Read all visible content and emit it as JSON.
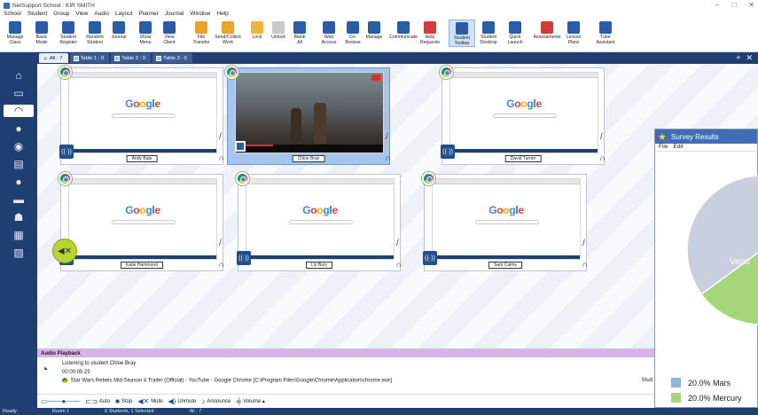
{
  "window": {
    "title": "NetSupport School : KIR SMITH",
    "controls": [
      "–",
      "□",
      "✕"
    ]
  },
  "menu": [
    "School",
    "Student",
    "Group",
    "View",
    "Audio",
    "Layout",
    "Planner",
    "Journal",
    "Window",
    "Help"
  ],
  "toolbar": [
    {
      "label": "Manage\nClass",
      "icon": "manage-class-icon",
      "color": "#2a5ca8"
    },
    {
      "label": "Basic\nMode",
      "icon": "basic-mode-icon",
      "color": "#2a5ca8"
    },
    {
      "label": "Student\nRegister",
      "icon": "student-register-icon",
      "color": "#2a5ca8"
    },
    {
      "label": "Random\nStudent",
      "icon": "random-student-icon",
      "color": "#2a5ca8"
    },
    {
      "label": "Journal",
      "icon": "journal-icon",
      "color": "#2a5ca8"
    },
    {
      "label": "Show\nMenu",
      "icon": "show-icon",
      "color": "#2a5ca8"
    },
    {
      "label": "View\nClient",
      "icon": "view-client-icon",
      "color": "#2a5ca8"
    },
    {
      "label": "File\nTransfer",
      "icon": "file-transfer-icon",
      "color": "#e8a52a"
    },
    {
      "label": "Send/Collect\nWork",
      "icon": "send-collect-icon",
      "color": "#e8a52a"
    },
    {
      "label": "Lock",
      "icon": "lock-icon",
      "color": "#f0b43c"
    },
    {
      "label": "Unlock",
      "icon": "unlock-icon",
      "color": "#c9c9c9"
    },
    {
      "label": "Blank\nAll",
      "icon": "blank-icon",
      "color": "#2a5ca8"
    },
    {
      "label": "Web\nAccess",
      "icon": "web-access-icon",
      "color": "#2a5ca8"
    },
    {
      "label": "Co-Browse",
      "icon": "co-browse-icon",
      "color": "#2a5ca8"
    },
    {
      "label": "Manage",
      "icon": "manage-icon",
      "color": "#2a5ca8"
    },
    {
      "label": "Communicate",
      "icon": "communicate-icon",
      "color": "#2a5ca8"
    },
    {
      "label": "Help\nRequests",
      "icon": "help-requests-icon",
      "color": "#d33b3b"
    },
    {
      "label": "Student\nToolbar",
      "icon": "student-toolbar-icon",
      "color": "#2a5ca8",
      "active": true
    },
    {
      "label": "Student\nDesktop",
      "icon": "student-desktop-icon",
      "color": "#2a5ca8"
    },
    {
      "label": "Quick\nLaunch",
      "icon": "quick-launch-icon",
      "color": "#2a5ca8"
    },
    {
      "label": "Assessments",
      "icon": "assessments-icon",
      "color": "#d33b3b"
    },
    {
      "label": "Lesson\nPlans",
      "icon": "lesson-plans-icon",
      "color": "#2a5ca8"
    },
    {
      "label": "Tutor\nAssistant",
      "icon": "tutor-assistant-icon",
      "color": "#2a5ca8"
    }
  ],
  "tabs": [
    {
      "label": "All : 7",
      "active": true
    },
    {
      "label": "Table 1 : 0",
      "active": false
    },
    {
      "label": "Table 2 : 0",
      "active": false
    },
    {
      "label": "Table 3 : 0",
      "active": false
    }
  ],
  "tabstrip_right": [
    "+",
    "✕"
  ],
  "sidebar": [
    {
      "icon": "home-icon",
      "glyph": "⌂"
    },
    {
      "icon": "monitor-icon",
      "glyph": "▭"
    },
    {
      "icon": "headphones-icon",
      "glyph": "◠",
      "selected": true
    },
    {
      "icon": "chat-icon",
      "glyph": "●"
    },
    {
      "icon": "globe-icon",
      "glyph": "◉"
    },
    {
      "icon": "window-icon",
      "glyph": "▤"
    },
    {
      "icon": "info-icon",
      "glyph": "●"
    },
    {
      "icon": "printer-icon",
      "glyph": "▬"
    },
    {
      "icon": "users-icon",
      "glyph": "☗"
    },
    {
      "icon": "grid-icon",
      "glyph": "▦"
    },
    {
      "icon": "image-icon",
      "glyph": "▨"
    }
  ],
  "students": [
    {
      "name": "Andy Bats",
      "app": "chrome",
      "screen": "google",
      "selected": false,
      "muted": false
    },
    {
      "name": "Chloe Bray",
      "app": "chrome",
      "screen": "video",
      "selected": true,
      "muted": false
    },
    {
      "name": "David Turner",
      "app": "chrome",
      "screen": "google",
      "selected": false,
      "muted": false
    },
    {
      "name": "Katie Hammond",
      "app": "chrome",
      "screen": "google",
      "selected": false,
      "muted": true
    },
    {
      "name": "Liz Bury",
      "app": "chrome",
      "screen": "google",
      "selected": false,
      "muted": false
    },
    {
      "name": "Sam Calms",
      "app": "chrome",
      "screen": "google",
      "selected": false,
      "muted": false
    }
  ],
  "google_logo": "Google",
  "survey": {
    "title": "Survey Results",
    "menu": [
      "File",
      "Edit"
    ],
    "pie_label": "Venu",
    "legend": [
      {
        "label": "20.0% Mars",
        "color": "#8fb4e0"
      },
      {
        "label": "20.0% Mercury",
        "color": "#a6d57a"
      }
    ]
  },
  "audio": {
    "header": "Audio Playback",
    "listening": "Listening to student Chloe Bray",
    "time": "00:00:05:25",
    "track": "Star Wars Rebels Mid-Season 4 Trailer (Official) - YouTube - Google Chrome [C:\\Program Files\\Google\\Chrome\\Application\\chrome.exe]",
    "stud_right": "Stud",
    "controls": [
      {
        "label": "Auto",
        "icon": "auto-icon",
        "glyph": "⊏⊐"
      },
      {
        "label": "Stop",
        "icon": "stop-icon",
        "glyph": "■"
      },
      {
        "label": "Mute",
        "icon": "mute-icon",
        "glyph": "◀✕"
      },
      {
        "label": "Unmute",
        "icon": "unmute-icon",
        "glyph": "◀)"
      },
      {
        "label": "Announce",
        "icon": "announce-icon",
        "glyph": "♪"
      },
      {
        "label": "Volume ▴",
        "icon": "volume-icon",
        "glyph": "╪"
      }
    ]
  },
  "status": [
    "Ready",
    "Room 1",
    "6 Students, 1 Selected",
    "All : 7"
  ]
}
